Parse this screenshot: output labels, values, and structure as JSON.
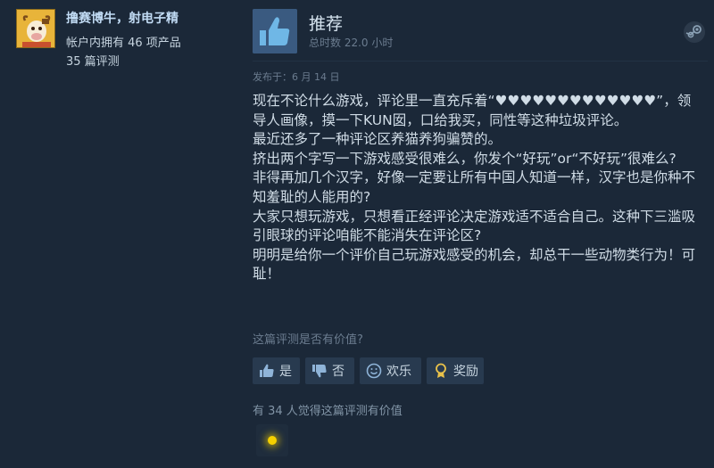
{
  "author": {
    "name": "撸赛博牛，射电子精",
    "products_owned": "帐户内拥有 46 项产品",
    "reviews_count": "35 篇评测"
  },
  "review": {
    "verdict": "推荐",
    "hours": "总时数 22.0 小时",
    "posted": "发布于：6 月 14 日",
    "body": "现在不论什么游戏，评论里一直充斥着“♥♥♥♥♥♥♥♥♥♥♥♥♥”，领导人画像，摸一下KUN囡，口给我买，同性等这种垃圾评论。\n最近还多了一种评论区养猫养狗骗赞的。\n挤出两个字写一下游戏感受很难么，你发个“好玩”or“不好玩”很难么?\n非得再加几个汉字，好像一定要让所有中国人知道一样，汉字也是你种不知羞耻的人能用的?\n大家只想玩游戏，只想看正经评论决定游戏适不适合自己。这种下三滥吸引眼球的评论咱能不能消失在评论区?\n明明是给你一个评价自己玩游戏感受的机会，却总干一些动物类行为！可耻！"
  },
  "feedback": {
    "question": "这篇评测是否有价值?",
    "yes_label": "是",
    "no_label": "否",
    "funny_label": "欢乐",
    "award_label": "奖励",
    "helpful_count": "有 34 人觉得这篇评测有价值"
  },
  "icons": {
    "verdict": "thumbs-up-icon",
    "platform": "steam-logo-icon",
    "award": "award-icon"
  },
  "colors": {
    "background": "#1b2838",
    "author_name": "#c1dbf4",
    "verdict_box": "#3a5a80",
    "button_bg": "#283a4f",
    "award_glow": "#f5d000"
  }
}
